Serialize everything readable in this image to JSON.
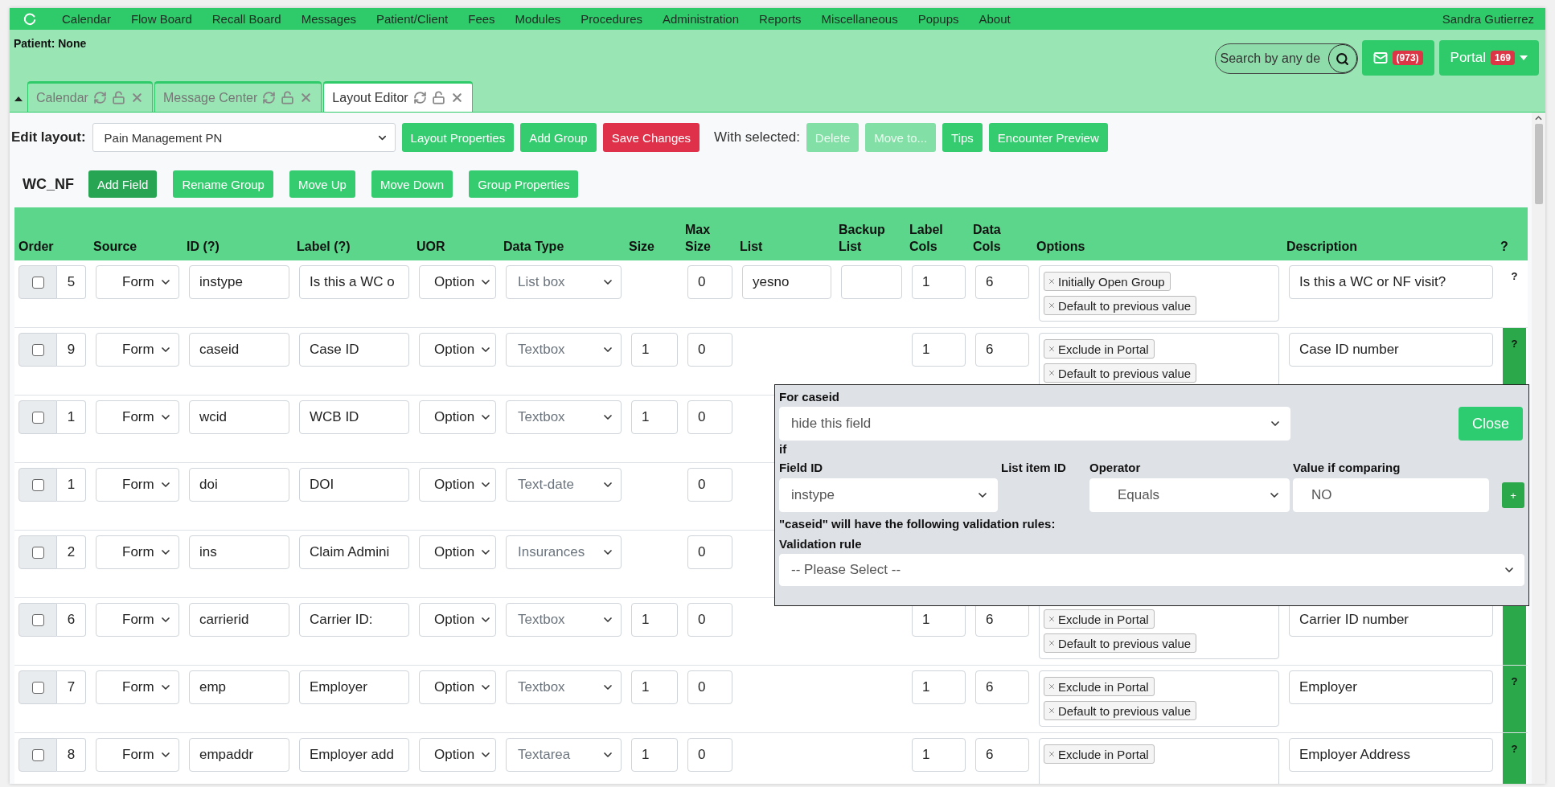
{
  "nav": {
    "items": [
      "Calendar",
      "Flow Board",
      "Recall Board",
      "Messages",
      "Patient/Client",
      "Fees",
      "Modules",
      "Procedures",
      "Administration",
      "Reports",
      "Miscellaneous",
      "Popups",
      "About"
    ],
    "user": "Sandra Gutierrez"
  },
  "header": {
    "patient": "Patient: None",
    "search": {
      "placeholder": "Search by any de"
    },
    "messages": {
      "badge": "(973)"
    },
    "portal": {
      "label": "Portal",
      "badge": "169"
    }
  },
  "tabs": [
    {
      "label": "Calendar",
      "selected": false
    },
    {
      "label": "Message Center",
      "selected": false
    },
    {
      "label": "Layout Editor",
      "selected": true
    }
  ],
  "toolbar": {
    "label": "Edit layout:",
    "layout": "Pain Management PN",
    "items": [
      {
        "kind": "button",
        "label": "Layout Properties",
        "disabled": false
      },
      {
        "kind": "button",
        "label": "Add Group",
        "disabled": false
      },
      {
        "kind": "danger",
        "label": "Save Changes",
        "disabled": false
      },
      {
        "kind": "text",
        "label": "With selected:"
      },
      {
        "kind": "button",
        "label": "Delete",
        "disabled": true
      },
      {
        "kind": "button",
        "label": "Move to...",
        "disabled": true
      },
      {
        "kind": "button",
        "label": "Tips",
        "disabled": false
      },
      {
        "kind": "button",
        "label": "Encounter Preview",
        "disabled": false
      }
    ]
  },
  "group": {
    "name": "WC_NF",
    "buttons": [
      {
        "label": "Add Field",
        "kind": "dark"
      },
      {
        "label": "Rename Group",
        "kind": "button"
      },
      {
        "label": "Move Up",
        "kind": "button"
      },
      {
        "label": "Move Down",
        "kind": "button"
      },
      {
        "label": "Group Properties",
        "kind": "button"
      }
    ]
  },
  "table": {
    "columns": [
      "Order",
      "Source",
      "ID (?)",
      "Label (?)",
      "UOR",
      "Data Type",
      "Size",
      "Max Size",
      "List",
      "Backup List",
      "Label Cols",
      "Data Cols",
      "Options",
      "Description",
      "?"
    ],
    "rows": [
      {
        "checked": false,
        "order": "5",
        "source": "Form",
        "id": "instype",
        "label": "Is this a WC o",
        "uor": "Option",
        "data_type": "List box",
        "max_size": "0",
        "list": "yesno",
        "backup_list_box": true,
        "label_cols": "1",
        "data_cols": "6",
        "options": [
          "Initially Open Group",
          "Default to previous value"
        ],
        "description": "Is this a WC or NF visit?",
        "help": {
          "text": "?",
          "highlighted": false
        }
      },
      {
        "checked": false,
        "order": "9",
        "source": "Form",
        "id": "caseid",
        "label": "Case ID",
        "uor": "Option",
        "data_type": "Textbox",
        "size": "1",
        "max_size": "0",
        "backup_list_box": false,
        "label_cols": "1",
        "data_cols": "6",
        "options": [
          "Exclude in Portal",
          "Default to previous value"
        ],
        "description": "Case ID number",
        "help": {
          "text": "?",
          "highlighted": true
        }
      },
      {
        "checked": false,
        "order": "1",
        "source": "Form",
        "id": "wcid",
        "label": "WCB ID",
        "uor": "Option",
        "data_type": "Textbox",
        "size": "1",
        "max_size": "0",
        "backup_list_box": false
      },
      {
        "checked": false,
        "order": "1",
        "source": "Form",
        "id": "doi",
        "label": "DOI",
        "uor": "Option",
        "data_type": "Text-date",
        "max_size": "0",
        "backup_list_box": false
      },
      {
        "checked": false,
        "order": "2",
        "source": "Form",
        "id": "ins",
        "label": "Claim Admini",
        "uor": "Option",
        "data_type": "Insurances",
        "max_size": "0",
        "backup_list_box": false
      },
      {
        "checked": false,
        "order": "6",
        "source": "Form",
        "id": "carrierid",
        "label": "Carrier ID:",
        "uor": "Option",
        "data_type": "Textbox",
        "size": "1",
        "max_size": "0",
        "backup_list_box": false,
        "label_cols": "1",
        "data_cols": "6",
        "options": [
          "Exclude in Portal",
          "Default to previous value"
        ],
        "description": "Carrier ID number",
        "help": {
          "highlighted": true
        }
      },
      {
        "checked": false,
        "order": "7",
        "source": "Form",
        "id": "emp",
        "label": "Employer",
        "uor": "Option",
        "data_type": "Textbox",
        "size": "1",
        "max_size": "0",
        "backup_list_box": false,
        "label_cols": "1",
        "data_cols": "6",
        "options": [
          "Exclude in Portal",
          "Default to previous value"
        ],
        "description": "Employer",
        "help": {
          "text": "?",
          "highlighted": true
        }
      },
      {
        "checked": false,
        "order": "8",
        "source": "Form",
        "id": "empaddr",
        "label": "Employer add",
        "uor": "Option",
        "data_type": "Textarea",
        "size": "1",
        "max_size": "0",
        "backup_list_box": false,
        "label_cols": "1",
        "data_cols": "6",
        "options": [
          "Exclude in Portal"
        ],
        "description": "Employer Address",
        "help": {
          "text": "?",
          "highlighted": true
        }
      }
    ]
  },
  "popup": {
    "title": "For caseid",
    "action": "hide this field",
    "close": "Close",
    "if_label": "if",
    "headers": [
      "Field ID",
      "List item ID",
      "Operator",
      "Value if comparing"
    ],
    "field_id": "instype",
    "operator": "Equals",
    "value": "NO",
    "add": "+",
    "validation_note": "\"caseid\" will have the following validation rules:",
    "validation_label": "Validation rule",
    "validation": "-- Please Select --"
  }
}
